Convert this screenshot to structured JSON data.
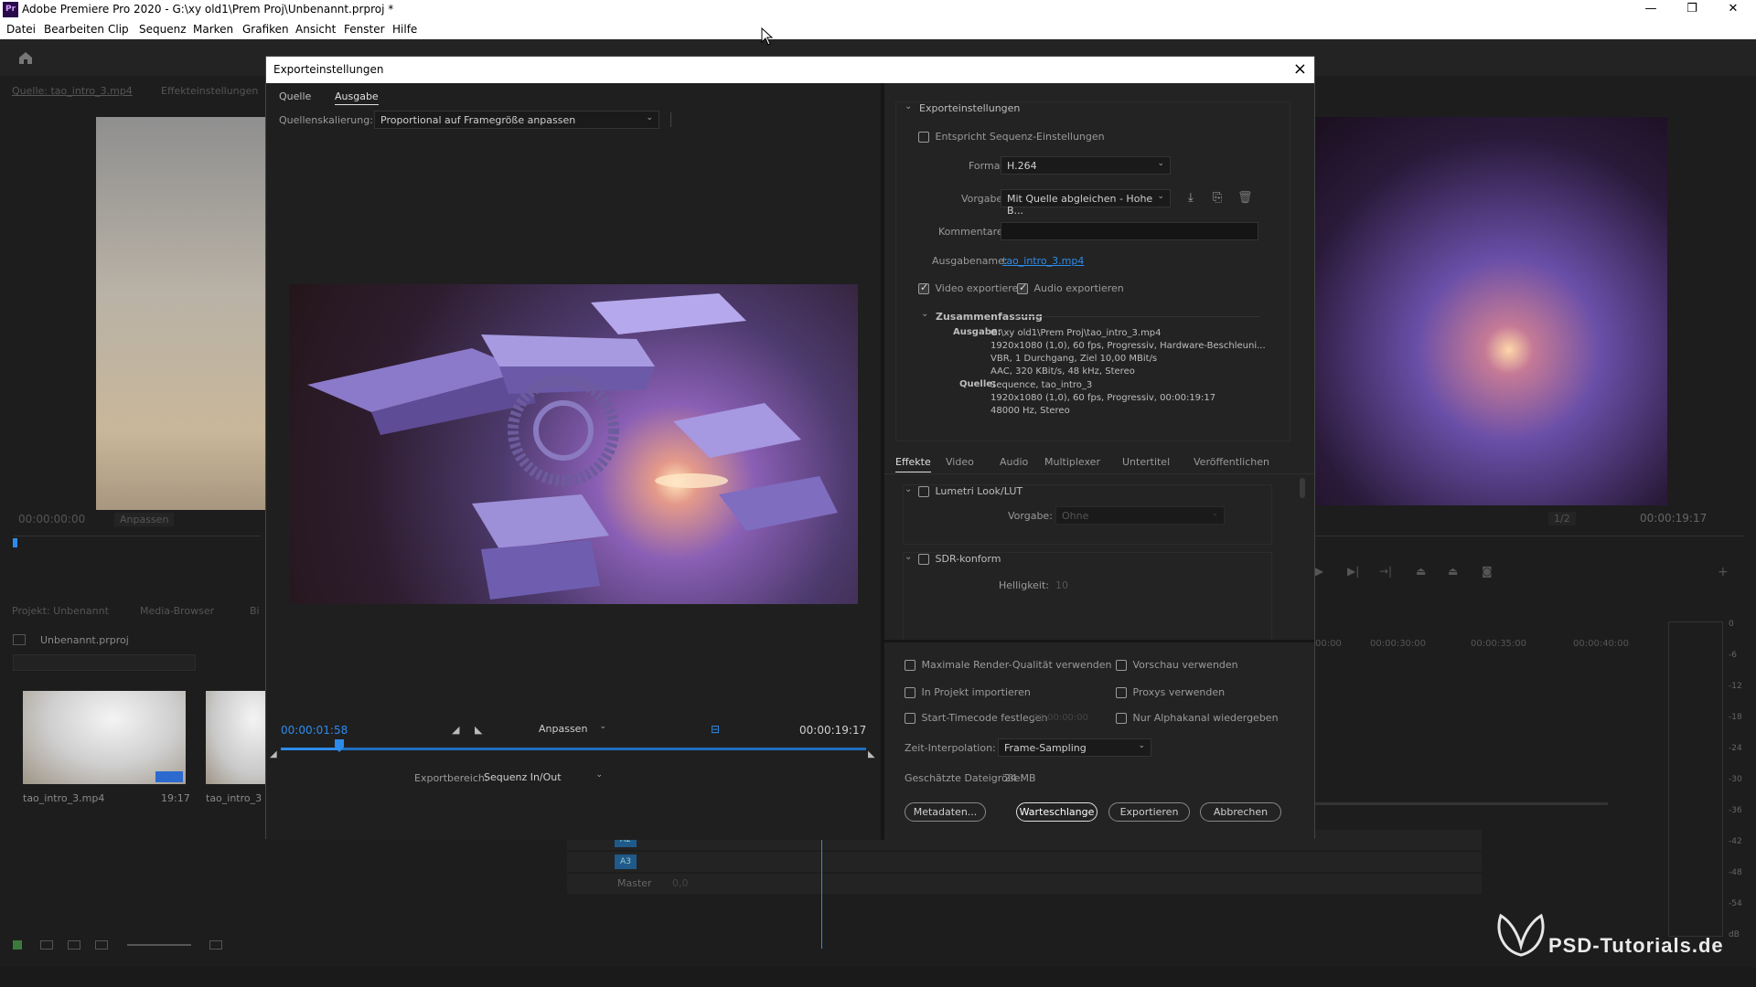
{
  "app": {
    "title": "Adobe Premiere Pro 2020 - G:\\xy old1\\Prem Proj\\Unbenannt.prproj *",
    "icon": "Pr"
  },
  "menu": [
    "Datei",
    "Bearbeiten",
    "Clip",
    "Sequenz",
    "Marken",
    "Grafiken",
    "Ansicht",
    "Fenster",
    "Hilfe"
  ],
  "source_panel": {
    "tabs": [
      "Quelle: tao_intro_3.mp4",
      "Effekteinstellungen"
    ],
    "timecode": "00:00:00:00",
    "fit": "Anpassen"
  },
  "project_panel": {
    "tabs": [
      "Projekt: Unbenannt",
      "Media-Browser",
      "Bi"
    ],
    "file": "Unbenannt.prproj",
    "items": [
      {
        "name": "tao_intro_3.mp4",
        "duration": "19:17"
      },
      {
        "name": "tao_intro_3",
        "duration": ""
      }
    ]
  },
  "program_panel": {
    "timecode": "00:00:19:17",
    "ratio": "1/2"
  },
  "timeline": {
    "ruler": [
      "00:00",
      "00:00:30:00",
      "00:00:35:00",
      "00:00:40:00"
    ],
    "tracks": [
      "A2",
      "A3"
    ],
    "master": "Master",
    "master_val": "0,0"
  },
  "meter": {
    "ticks": [
      "0",
      "-6",
      "-12",
      "-18",
      "-24",
      "-30",
      "-36",
      "-42",
      "-48",
      "-54",
      "dB"
    ]
  },
  "watermark": "PSD-Tutorials.de",
  "dialog": {
    "title": "Exporteinstellungen",
    "tabs": [
      "Quelle",
      "Ausgabe"
    ],
    "scaling_label": "Quellenskalierung:",
    "scaling_value": "Proportional auf Framegröße anpassen",
    "current_time": "00:00:01:58",
    "end_time": "00:00:19:17",
    "fit": "Anpassen",
    "range_label": "Exportbereich:",
    "range_value": "Sequenz In/Out",
    "progress": 0.1,
    "export_settings": {
      "header": "Exporteinstellungen",
      "match_seq": "Entspricht Sequenz-Einstellungen",
      "format_label": "Format:",
      "format_value": "H.264",
      "preset_label": "Vorgabe:",
      "preset_value": "Mit Quelle abgleichen - Hohe B...",
      "comment_label": "Kommentare:",
      "output_label": "Ausgabename:",
      "output_value": "tao_intro_3.mp4",
      "export_video": "Video exportieren",
      "export_audio": "Audio exportieren",
      "summary_header": "Zusammenfassung",
      "summary_out_label": "Ausgabe:",
      "summary_out": [
        "G:\\xy old1\\Prem Proj\\tao_intro_3.mp4",
        "1920x1080 (1,0), 60 fps, Progressiv, Hardware-Beschleuni...",
        "VBR, 1 Durchgang, Ziel 10,00 MBit/s",
        "AAC, 320 KBit/s, 48 kHz, Stereo"
      ],
      "summary_src_label": "Quelle:",
      "summary_src": [
        "Sequence, tao_intro_3",
        "1920x1080 (1,0), 60 fps, Progressiv, 00:00:19:17",
        "48000 Hz, Stereo"
      ]
    },
    "sub_tabs": [
      "Effekte",
      "Video",
      "Audio",
      "Multiplexer",
      "Untertitel",
      "Veröffentlichen"
    ],
    "effects": {
      "lumetri": "Lumetri Look/LUT",
      "lumetri_preset_label": "Vorgabe:",
      "lumetri_preset_value": "Ohne",
      "sdr": "SDR-konform",
      "brightness_label": "Helligkeit:",
      "brightness_value": "10"
    },
    "options": {
      "max_render": "Maximale Render-Qualität verwenden",
      "use_preview": "Vorschau verwenden",
      "import_project": "In Projekt importieren",
      "use_proxies": "Proxys verwenden",
      "start_tc": "Start-Timecode festlegen",
      "start_tc_value": "00:00:00:00",
      "alpha_only": "Nur Alphakanal wiedergeben",
      "interp_label": "Zeit-Interpolation:",
      "interp_value": "Frame-Sampling",
      "filesize_label": "Geschätzte Dateigröße:",
      "filesize_value": "24 MB"
    },
    "buttons": {
      "metadata": "Metadaten...",
      "queue": "Warteschlange",
      "export": "Exportieren",
      "cancel": "Abbrechen"
    }
  },
  "colors": {
    "accent": "#2d8ceb",
    "panel": "#1d1d1d",
    "dialog": "#1f1f1f"
  }
}
